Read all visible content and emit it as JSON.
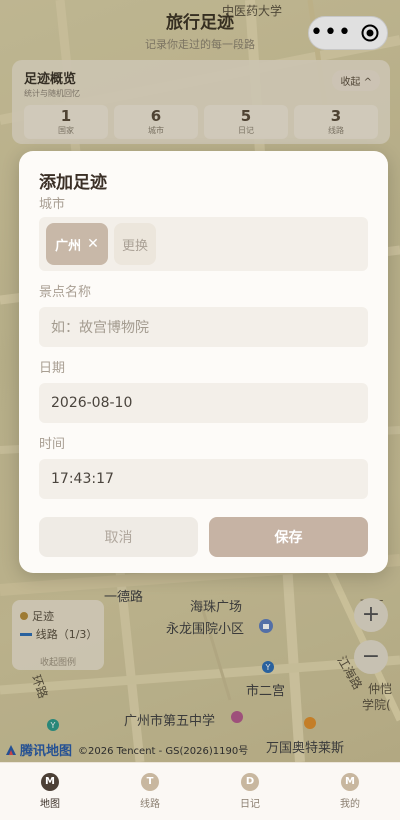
{
  "map": {
    "title": "旅行足迹",
    "subtitle": "记录你走过的每一段路",
    "labels": {
      "zhongyi": "中医药大学",
      "haizhu": "海珠广场",
      "yidelu": "一德路",
      "yonglong": "永龙围院小区",
      "shiergong": "市二宫",
      "wuzhong": "广州市第五中学",
      "wanguo": "万国奥特莱斯",
      "zhujiang": "珠江",
      "jianghailu": "江海路",
      "zhongkai": "仲恺",
      "xueyuan": "学院(",
      "huanlu": "环路"
    },
    "attribution": {
      "logo": "腾讯地图",
      "copyright": "©2026 Tencent - GS(2026)1190号"
    }
  },
  "capsule": {
    "more_icon": "more-dots-icon",
    "close_icon": "target-close-icon"
  },
  "overview": {
    "title": "足迹概览",
    "subtitle": "统计与随机回忆",
    "collapse_label": "收起 ^",
    "stats": [
      {
        "value": "1",
        "label": "国家"
      },
      {
        "value": "6",
        "label": "城市"
      },
      {
        "value": "5",
        "label": "日记"
      },
      {
        "value": "3",
        "label": "线路"
      }
    ]
  },
  "legend": {
    "footprint": "足迹",
    "route": "线路（1/3）",
    "collapse": "收起图例"
  },
  "zoom": {
    "in": "+",
    "out": "−"
  },
  "dialog": {
    "title": "添加足迹",
    "city_label": "城市",
    "city_chip": "广州",
    "city_chip_remove": "✕",
    "city_change": "更换",
    "spot_label": "景点名称",
    "spot_placeholder": "如：故宫博物院",
    "date_label": "日期",
    "date_value": "2026-08-10",
    "time_label": "时间",
    "time_value": "17:43:17",
    "cancel_label": "取消",
    "save_label": "保存"
  },
  "tabbar": [
    {
      "icon": "M",
      "label": "地图",
      "active": true
    },
    {
      "icon": "T",
      "label": "线路",
      "active": false
    },
    {
      "icon": "D",
      "label": "日记",
      "active": false
    },
    {
      "icon": "M",
      "label": "我的",
      "active": false
    }
  ],
  "colors": {
    "accent": "#c6b3a4",
    "dark": "#4c4036",
    "route": "#2f6fb4"
  }
}
